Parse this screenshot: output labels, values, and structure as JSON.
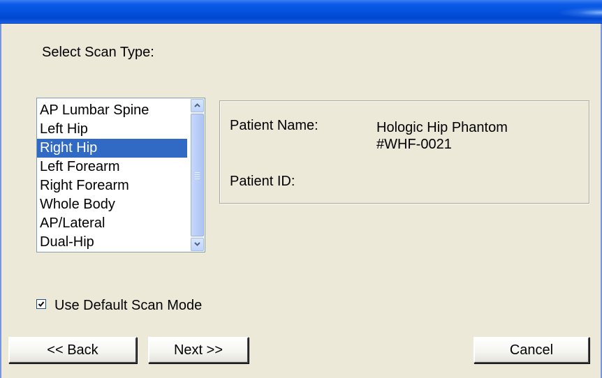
{
  "window": {
    "title": ""
  },
  "prompt": "Select Scan Type:",
  "scan_types": [
    "AP Lumbar Spine",
    "Left Hip",
    "Right Hip",
    "Left Forearm",
    "Right Forearm",
    "Whole Body",
    "AP/Lateral",
    "Dual-Hip"
  ],
  "selected_scan_type": "Right Hip",
  "patient": {
    "name_label": "Patient Name:",
    "name_line1": "Hologic Hip Phantom",
    "name_line2": "#WHF-0021",
    "id_label": "Patient ID:",
    "id_value": ""
  },
  "default_scan_mode": {
    "label": "Use Default Scan Mode",
    "checked": true
  },
  "buttons": {
    "back": "<< Back",
    "next": "Next >>",
    "cancel": "Cancel"
  },
  "icons": {
    "scroll_up": "chevron-up-icon",
    "scroll_down": "chevron-down-icon",
    "checkbox_mark": "checkmark-icon"
  },
  "colors": {
    "titlebar": "#0451dd",
    "window_bg": "#ece9d8",
    "selection": "#316ac5",
    "selection_text": "#ffffff"
  }
}
